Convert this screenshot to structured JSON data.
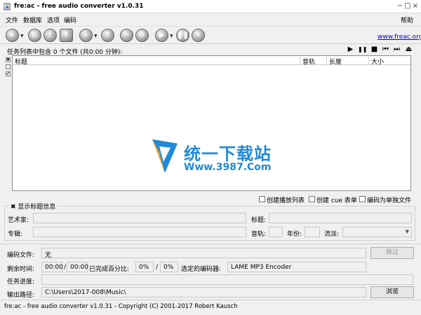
{
  "window": {
    "title": "fre:ac - free audio converter v1.0.31",
    "controls": [
      "−",
      "□",
      "×"
    ]
  },
  "menu": {
    "items": [
      "文件",
      "数据库",
      "选项",
      "编码"
    ],
    "help": "帮助"
  },
  "toolbar": {
    "icons": [
      "add-files-icon",
      "cddb-icon",
      "cddb-query-icon",
      "cddb-submit-icon",
      "search-icon",
      "cddb-edit-icon",
      "settings-icon",
      "config-icon",
      "start-encode-icon",
      "pause-icon",
      "stop-icon"
    ],
    "site_link": "www.freac.org"
  },
  "joblist": {
    "summary": "任务列表中包含 0 个文件 (共0:00 分钟):",
    "controls": [
      "▶",
      "❚❚",
      "■",
      "⏮",
      "⏭",
      "⏏"
    ],
    "columns": [
      "标题",
      "音轨",
      "长度",
      "大小"
    ],
    "side_checks": [
      "✖",
      "",
      "✔"
    ]
  },
  "watermark": {
    "title": "统一下载站",
    "url": "Www.3987.Com"
  },
  "options": {
    "create_playlist": "创建播放列表",
    "create_cue": "创建 cue 表单",
    "encode_single": "编码为单独文件"
  },
  "info_panel": {
    "toggle": "✖ 显示标题信息",
    "artist_label": "艺术家:",
    "title_label": "标题:",
    "album_label": "专辑:",
    "track_label": "音轨:",
    "year_label": "年份:",
    "genre_label": "流派:"
  },
  "encode": {
    "file_label": "编码文件:",
    "file_value": "无",
    "skip_button": "跳过",
    "time_left_label": "剩余时间:",
    "time_left": "00:00",
    "time_total": "00:00",
    "time_sep": "/",
    "percent_label": "已完成百分比:",
    "percent_done": "0%",
    "percent_sep": "/",
    "percent_total": "0%",
    "encoder_label": "选定的编码器:",
    "encoder_value": "LAME MP3 Encoder",
    "progress_label": "任务进度:",
    "progress": 0,
    "output_label": "输出路径:",
    "output_value": "C:\\Users\\2017-008\\Music\\",
    "browse_button": "浏览"
  },
  "statusbar": {
    "text": "fre:ac - free audio converter v1.0.31 - Copyright (C) 2001-2017 Robert Kausch"
  }
}
